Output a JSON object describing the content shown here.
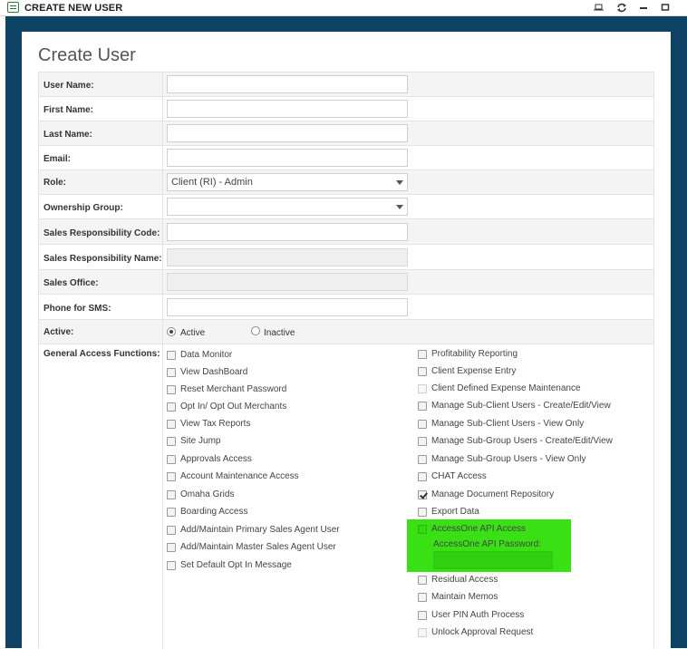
{
  "window": {
    "title": "CREATE NEW USER",
    "controls": [
      "pin-icon",
      "refresh-icon",
      "minimize-icon",
      "maximize-icon"
    ]
  },
  "page": {
    "title": "Create User"
  },
  "form": {
    "fields": {
      "user_name": {
        "label": "User Name:",
        "value": ""
      },
      "first_name": {
        "label": "First Name:",
        "value": ""
      },
      "last_name": {
        "label": "Last Name:",
        "value": ""
      },
      "email": {
        "label": "Email:",
        "value": ""
      },
      "role": {
        "label": "Role:",
        "value": "Client (RI) - Admin"
      },
      "ownership_group": {
        "label": "Ownership Group:",
        "value": ""
      },
      "sales_resp_code": {
        "label": "Sales Responsibility Code:",
        "value": ""
      },
      "sales_resp_name": {
        "label": "Sales Responsibility Name:",
        "value": ""
      },
      "sales_office": {
        "label": "Sales Office:",
        "value": ""
      },
      "phone_sms": {
        "label": "Phone for SMS:",
        "value": ""
      },
      "active": {
        "label": "Active:",
        "options": [
          "Active",
          "Inactive"
        ],
        "selected": "Active"
      }
    },
    "general_access": {
      "label": "General Access Functions:",
      "left": [
        {
          "label": "Data Monitor",
          "checked": false
        },
        {
          "label": "View DashBoard",
          "checked": false
        },
        {
          "label": "Reset Merchant Password",
          "checked": false
        },
        {
          "label": "Opt In/ Opt Out Merchants",
          "checked": false
        },
        {
          "label": "View Tax Reports",
          "checked": false
        },
        {
          "label": "Site Jump",
          "checked": false
        },
        {
          "label": "Approvals Access",
          "checked": false
        },
        {
          "label": "Account Maintenance Access",
          "checked": false
        },
        {
          "label": "Omaha Grids",
          "checked": false
        },
        {
          "label": "Boarding Access",
          "checked": false
        },
        {
          "label": "Add/Maintain Primary Sales Agent User",
          "checked": false
        },
        {
          "label": "Add/Maintain Master Sales Agent User",
          "checked": false
        },
        {
          "label": "Set Default Opt In Message",
          "checked": false
        }
      ],
      "right": [
        {
          "label": "Profitability Reporting",
          "checked": false
        },
        {
          "label": "Client Expense Entry",
          "checked": false
        },
        {
          "label": "Client Defined Expense Maintenance",
          "checked": false,
          "disabled": true
        },
        {
          "label": "Manage Sub-Client Users - Create/Edit/View",
          "checked": false
        },
        {
          "label": "Manage Sub-Client Users - View Only",
          "checked": false
        },
        {
          "label": "Manage Sub-Group Users - Create/Edit/View",
          "checked": false
        },
        {
          "label": "Manage Sub-Group Users - View Only",
          "checked": false
        },
        {
          "label": "CHAT Access",
          "checked": false
        },
        {
          "label": "Manage Document Repository",
          "checked": true
        },
        {
          "label": "Export Data",
          "checked": false
        },
        {
          "label": "AccessOne API Access",
          "checked": false
        },
        {
          "label": "Residual Access",
          "checked": false
        },
        {
          "label": "Maintain Memos",
          "checked": false
        },
        {
          "label": "User PIN Auth Process",
          "checked": false
        },
        {
          "label": "Unlock Approval Request",
          "checked": false,
          "disabled": true
        }
      ],
      "api_password": {
        "label": "AccessOne API Password:",
        "value": ""
      }
    }
  },
  "colors": {
    "frame": "#0f4366",
    "highlight": "#39e114",
    "row_alt": "#f4f4f4"
  }
}
